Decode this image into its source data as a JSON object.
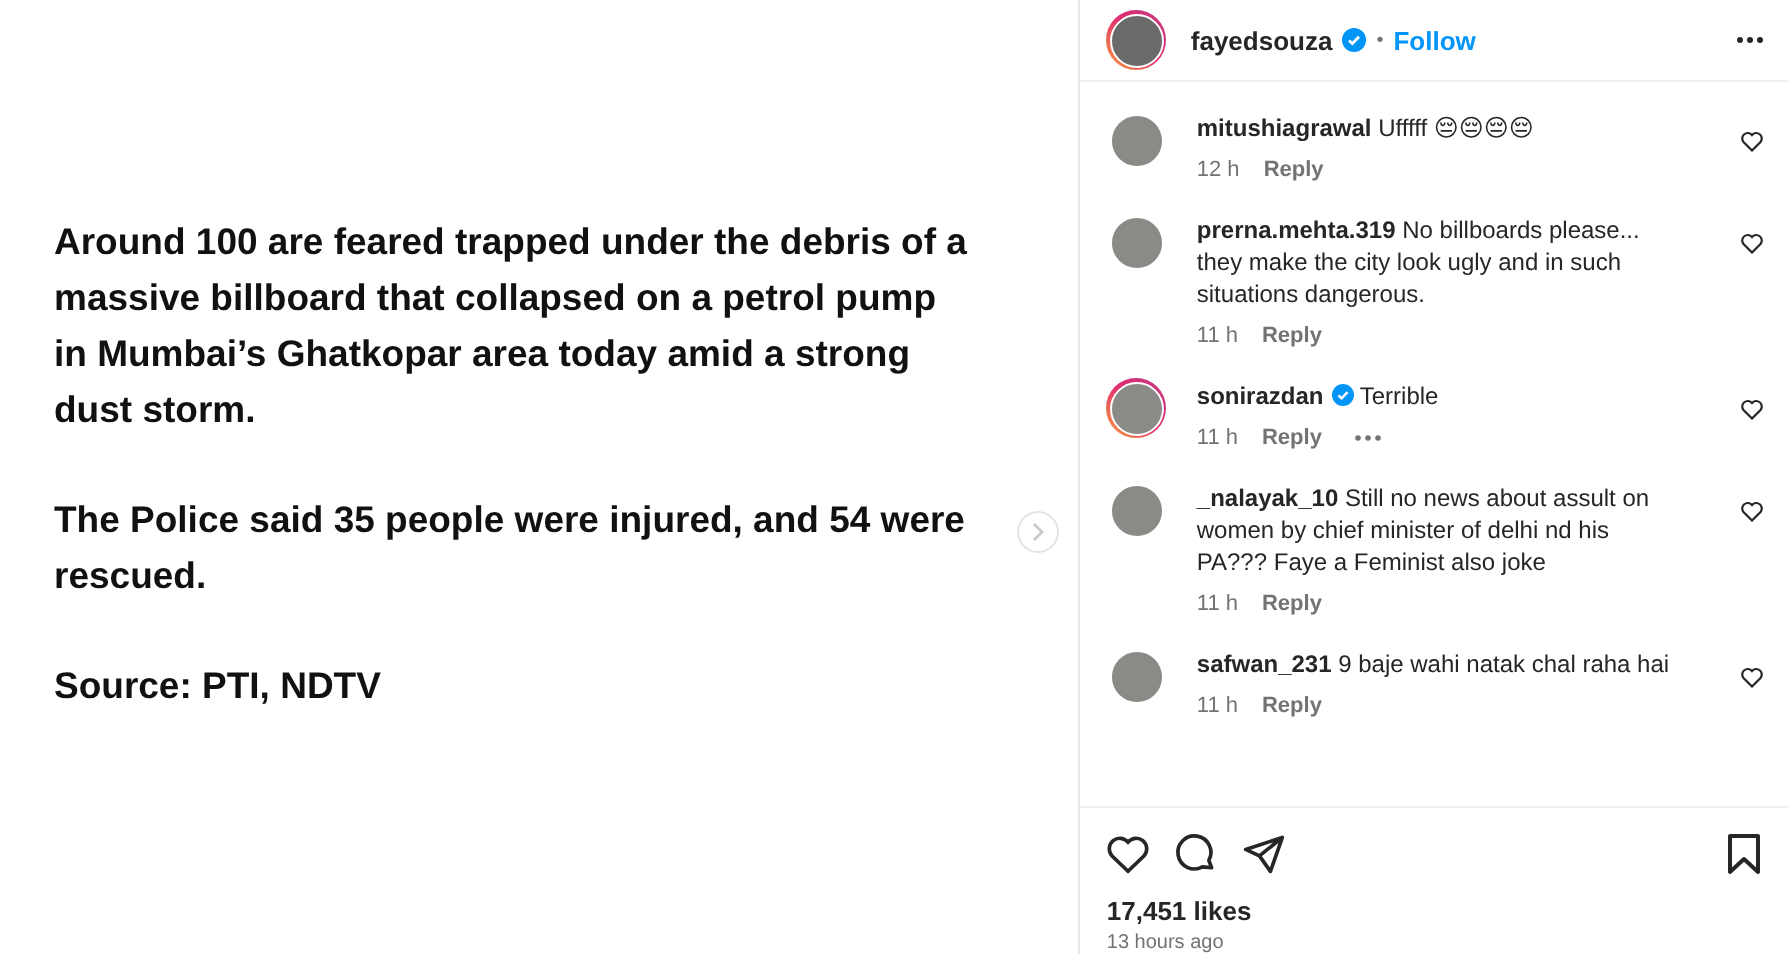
{
  "post": {
    "paragraphs": [
      "Around 100 are feared trapped under the debris of a massive billboard that collapsed on a petrol pump in Mumbai’s Ghatkopar area today amid a strong dust storm.",
      "The Police said 35 people were injured, and 54 were rescued.",
      "Source: PTI, NDTV"
    ]
  },
  "header": {
    "username": "fayedsouza",
    "verified": true,
    "story_ring": true,
    "separator": "•",
    "follow": "Follow"
  },
  "comments": [
    {
      "username": "mitushiagrawal",
      "verified": false,
      "story_ring": false,
      "text": "Ufffff 😔😔😔😔",
      "time": "12 h",
      "reply": "Reply",
      "more": false
    },
    {
      "username": "prerna.mehta.319",
      "verified": false,
      "story_ring": false,
      "text": "No billboards please... they make the city look ugly and in such situations dangerous.",
      "time": "11 h",
      "reply": "Reply",
      "more": false
    },
    {
      "username": "sonirazdan",
      "verified": true,
      "story_ring": true,
      "text": "Terrible",
      "time": "11 h",
      "reply": "Reply",
      "more": true
    },
    {
      "username": "_nalayak_10",
      "verified": false,
      "story_ring": false,
      "text": "Still no news about assult on women by chief minister of delhi nd his PA??? Faye a Feminist also joke",
      "time": "11 h",
      "reply": "Reply",
      "more": false
    },
    {
      "username": "safwan_231",
      "verified": false,
      "story_ring": false,
      "text": "9 baje wahi natak chal raha hai",
      "time": "11 h",
      "reply": "Reply",
      "more": false
    }
  ],
  "footer": {
    "likes": "17,451 likes",
    "posted": "13 hours ago"
  }
}
